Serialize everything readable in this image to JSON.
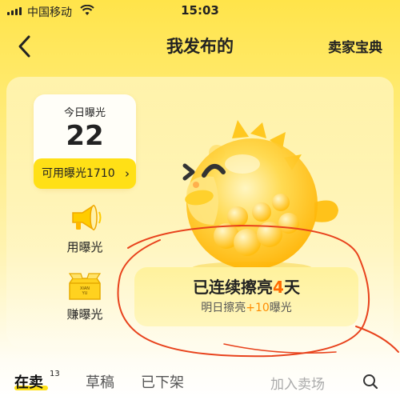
{
  "status_bar": {
    "carrier": "中国移动",
    "time": "15:03"
  },
  "nav": {
    "title": "我发布的",
    "right_link": "卖家宝典"
  },
  "exposure": {
    "label": "今日曝光",
    "value": "22",
    "available_label": "可用曝光1710"
  },
  "side_actions": [
    {
      "label": "用曝光",
      "icon": "megaphone-icon"
    },
    {
      "label": "赚曝光",
      "icon": "box-icon",
      "box_text_top": "XIAN",
      "box_text_bottom": "YU"
    }
  ],
  "streak": {
    "title_pre": "已连续擦亮",
    "days": "4",
    "title_post": "天",
    "sub_pre": "明日擦亮",
    "bonus": "+10",
    "sub_post": "曝光"
  },
  "tabs": {
    "on_sale_label": "在卖",
    "on_sale_count": "13",
    "draft_label": "草稿",
    "removed_label": "已下架",
    "add_store_label": "加入卖场"
  },
  "colors": {
    "accent": "#ffe016",
    "highlight": "#ff6a00",
    "annotation": "#e8421c"
  }
}
